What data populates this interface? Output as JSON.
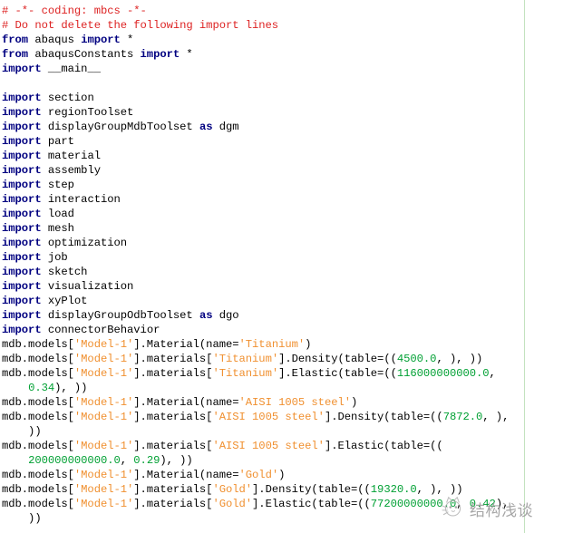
{
  "editor": {
    "language": "python",
    "column_guide_column": 80,
    "colors": {
      "comment": "#dd2222",
      "keyword": "#000080",
      "string": "#f09030",
      "number": "#00a033",
      "plain": "#000000",
      "background": "#ffffff",
      "column_guide": "#c3e2bf"
    }
  },
  "watermark": {
    "text": "结构浅谈",
    "logo_name": "cat-face-logo"
  },
  "code": {
    "lines": [
      {
        "tokens": [
          {
            "t": "comment",
            "v": "# -*- coding: mbcs -*-"
          }
        ]
      },
      {
        "tokens": [
          {
            "t": "comment",
            "v": "# Do not delete the following import lines"
          }
        ]
      },
      {
        "tokens": [
          {
            "t": "keyword",
            "v": "from"
          },
          {
            "t": "plain",
            "v": " abaqus "
          },
          {
            "t": "keyword",
            "v": "import"
          },
          {
            "t": "plain",
            "v": " *"
          }
        ]
      },
      {
        "tokens": [
          {
            "t": "keyword",
            "v": "from"
          },
          {
            "t": "plain",
            "v": " abaqusConstants "
          },
          {
            "t": "keyword",
            "v": "import"
          },
          {
            "t": "plain",
            "v": " *"
          }
        ]
      },
      {
        "tokens": [
          {
            "t": "keyword",
            "v": "import"
          },
          {
            "t": "plain",
            "v": " __main__"
          }
        ]
      },
      {
        "tokens": []
      },
      {
        "tokens": [
          {
            "t": "keyword",
            "v": "import"
          },
          {
            "t": "plain",
            "v": " section"
          }
        ]
      },
      {
        "tokens": [
          {
            "t": "keyword",
            "v": "import"
          },
          {
            "t": "plain",
            "v": " regionToolset"
          }
        ]
      },
      {
        "tokens": [
          {
            "t": "keyword",
            "v": "import"
          },
          {
            "t": "plain",
            "v": " displayGroupMdbToolset "
          },
          {
            "t": "keyword",
            "v": "as"
          },
          {
            "t": "plain",
            "v": " dgm"
          }
        ]
      },
      {
        "tokens": [
          {
            "t": "keyword",
            "v": "import"
          },
          {
            "t": "plain",
            "v": " part"
          }
        ]
      },
      {
        "tokens": [
          {
            "t": "keyword",
            "v": "import"
          },
          {
            "t": "plain",
            "v": " material"
          }
        ]
      },
      {
        "tokens": [
          {
            "t": "keyword",
            "v": "import"
          },
          {
            "t": "plain",
            "v": " assembly"
          }
        ]
      },
      {
        "tokens": [
          {
            "t": "keyword",
            "v": "import"
          },
          {
            "t": "plain",
            "v": " step"
          }
        ]
      },
      {
        "tokens": [
          {
            "t": "keyword",
            "v": "import"
          },
          {
            "t": "plain",
            "v": " interaction"
          }
        ]
      },
      {
        "tokens": [
          {
            "t": "keyword",
            "v": "import"
          },
          {
            "t": "plain",
            "v": " load"
          }
        ]
      },
      {
        "tokens": [
          {
            "t": "keyword",
            "v": "import"
          },
          {
            "t": "plain",
            "v": " mesh"
          }
        ]
      },
      {
        "tokens": [
          {
            "t": "keyword",
            "v": "import"
          },
          {
            "t": "plain",
            "v": " optimization"
          }
        ]
      },
      {
        "tokens": [
          {
            "t": "keyword",
            "v": "import"
          },
          {
            "t": "plain",
            "v": " job"
          }
        ]
      },
      {
        "tokens": [
          {
            "t": "keyword",
            "v": "import"
          },
          {
            "t": "plain",
            "v": " sketch"
          }
        ]
      },
      {
        "tokens": [
          {
            "t": "keyword",
            "v": "import"
          },
          {
            "t": "plain",
            "v": " visualization"
          }
        ]
      },
      {
        "tokens": [
          {
            "t": "keyword",
            "v": "import"
          },
          {
            "t": "plain",
            "v": " xyPlot"
          }
        ]
      },
      {
        "tokens": [
          {
            "t": "keyword",
            "v": "import"
          },
          {
            "t": "plain",
            "v": " displayGroupOdbToolset "
          },
          {
            "t": "keyword",
            "v": "as"
          },
          {
            "t": "plain",
            "v": " dgo"
          }
        ]
      },
      {
        "tokens": [
          {
            "t": "keyword",
            "v": "import"
          },
          {
            "t": "plain",
            "v": " connectorBehavior"
          }
        ]
      },
      {
        "tokens": [
          {
            "t": "plain",
            "v": "mdb.models["
          },
          {
            "t": "string",
            "v": "'Model-1'"
          },
          {
            "t": "plain",
            "v": "].Material(name="
          },
          {
            "t": "string",
            "v": "'Titanium'"
          },
          {
            "t": "plain",
            "v": ")"
          }
        ]
      },
      {
        "tokens": [
          {
            "t": "plain",
            "v": "mdb.models["
          },
          {
            "t": "string",
            "v": "'Model-1'"
          },
          {
            "t": "plain",
            "v": "].materials["
          },
          {
            "t": "string",
            "v": "'Titanium'"
          },
          {
            "t": "plain",
            "v": "].Density(table=(("
          },
          {
            "t": "number",
            "v": "4500.0"
          },
          {
            "t": "plain",
            "v": ", ), ))"
          }
        ]
      },
      {
        "tokens": [
          {
            "t": "plain",
            "v": "mdb.models["
          },
          {
            "t": "string",
            "v": "'Model-1'"
          },
          {
            "t": "plain",
            "v": "].materials["
          },
          {
            "t": "string",
            "v": "'Titanium'"
          },
          {
            "t": "plain",
            "v": "].Elastic(table=(("
          },
          {
            "t": "number",
            "v": "116000000000.0"
          },
          {
            "t": "plain",
            "v": ","
          }
        ]
      },
      {
        "tokens": [
          {
            "t": "plain",
            "v": "    "
          },
          {
            "t": "number",
            "v": "0.34"
          },
          {
            "t": "plain",
            "v": "), ))"
          }
        ]
      },
      {
        "tokens": [
          {
            "t": "plain",
            "v": "mdb.models["
          },
          {
            "t": "string",
            "v": "'Model-1'"
          },
          {
            "t": "plain",
            "v": "].Material(name="
          },
          {
            "t": "string",
            "v": "'AISI 1005 steel'"
          },
          {
            "t": "plain",
            "v": ")"
          }
        ]
      },
      {
        "tokens": [
          {
            "t": "plain",
            "v": "mdb.models["
          },
          {
            "t": "string",
            "v": "'Model-1'"
          },
          {
            "t": "plain",
            "v": "].materials["
          },
          {
            "t": "string",
            "v": "'AISI 1005 steel'"
          },
          {
            "t": "plain",
            "v": "].Density(table=(("
          },
          {
            "t": "number",
            "v": "7872.0"
          },
          {
            "t": "plain",
            "v": ", ),"
          }
        ]
      },
      {
        "tokens": [
          {
            "t": "plain",
            "v": "    ))"
          }
        ]
      },
      {
        "tokens": [
          {
            "t": "plain",
            "v": "mdb.models["
          },
          {
            "t": "string",
            "v": "'Model-1'"
          },
          {
            "t": "plain",
            "v": "].materials["
          },
          {
            "t": "string",
            "v": "'AISI 1005 steel'"
          },
          {
            "t": "plain",
            "v": "].Elastic(table=(("
          }
        ]
      },
      {
        "tokens": [
          {
            "t": "plain",
            "v": "    "
          },
          {
            "t": "number",
            "v": "200000000000.0"
          },
          {
            "t": "plain",
            "v": ", "
          },
          {
            "t": "number",
            "v": "0.29"
          },
          {
            "t": "plain",
            "v": "), ))"
          }
        ]
      },
      {
        "tokens": [
          {
            "t": "plain",
            "v": "mdb.models["
          },
          {
            "t": "string",
            "v": "'Model-1'"
          },
          {
            "t": "plain",
            "v": "].Material(name="
          },
          {
            "t": "string",
            "v": "'Gold'"
          },
          {
            "t": "plain",
            "v": ")"
          }
        ]
      },
      {
        "tokens": [
          {
            "t": "plain",
            "v": "mdb.models["
          },
          {
            "t": "string",
            "v": "'Model-1'"
          },
          {
            "t": "plain",
            "v": "].materials["
          },
          {
            "t": "string",
            "v": "'Gold'"
          },
          {
            "t": "plain",
            "v": "].Density(table=(("
          },
          {
            "t": "number",
            "v": "19320.0"
          },
          {
            "t": "plain",
            "v": ", ), ))"
          }
        ]
      },
      {
        "tokens": [
          {
            "t": "plain",
            "v": "mdb.models["
          },
          {
            "t": "string",
            "v": "'Model-1'"
          },
          {
            "t": "plain",
            "v": "].materials["
          },
          {
            "t": "string",
            "v": "'Gold'"
          },
          {
            "t": "plain",
            "v": "].Elastic(table=(("
          },
          {
            "t": "number",
            "v": "77200000000.0"
          },
          {
            "t": "plain",
            "v": ", "
          },
          {
            "t": "number",
            "v": "0.42"
          },
          {
            "t": "plain",
            "v": "),"
          }
        ]
      },
      {
        "tokens": [
          {
            "t": "plain",
            "v": "    ))"
          }
        ]
      }
    ]
  }
}
